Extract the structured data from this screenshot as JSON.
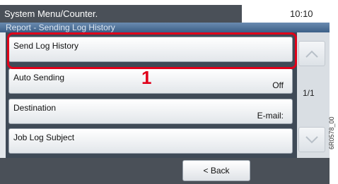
{
  "header": {
    "title": "System Menu/Counter.",
    "time": "10:10"
  },
  "breadcrumb": "Report - Sending Log History",
  "items": [
    {
      "label": "Send Log History",
      "value": ""
    },
    {
      "label": "Auto Sending",
      "value": "Off"
    },
    {
      "label": "Destination",
      "value": "E-mail:"
    },
    {
      "label": "Job Log Subject",
      "value": ""
    }
  ],
  "callout_number": "1",
  "page_indicator": "1/1",
  "buttons": {
    "back": "< Back"
  },
  "figure_code": "6R0578_00",
  "colors": {
    "highlight": "#e0001a",
    "header": "#4a5058"
  },
  "icons": {
    "scroll_up": "chevron-up-icon",
    "scroll_down": "chevron-down-icon"
  }
}
